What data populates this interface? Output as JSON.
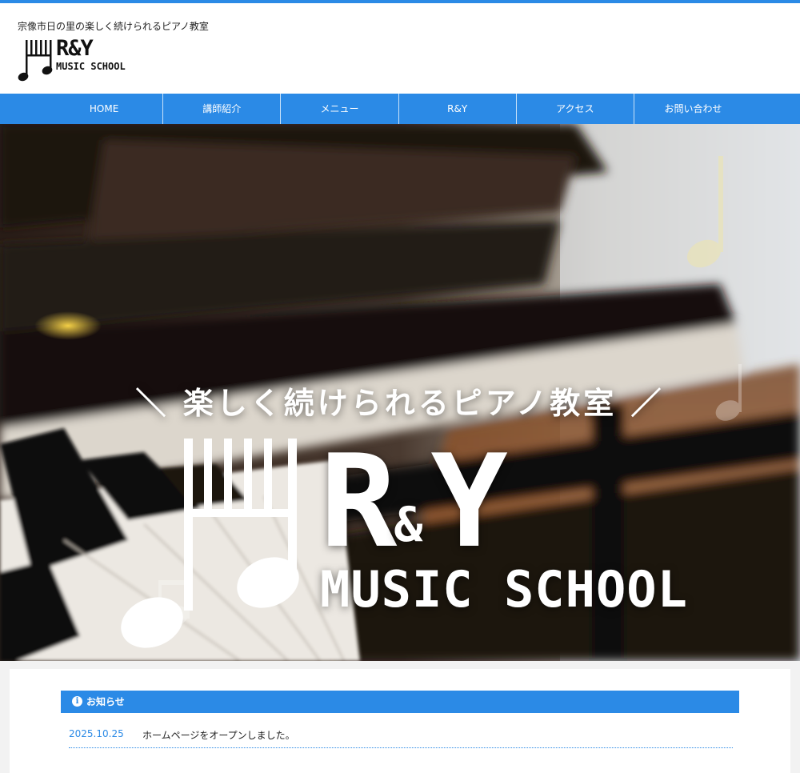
{
  "site": {
    "tagline": "宗像市日の里の楽しく続けられるピアノ教室",
    "logo": {
      "letters": "R&Y",
      "subtitle": "MUSIC SCHOOL",
      "icon": "piano-note-logo-icon"
    }
  },
  "nav": {
    "items": [
      {
        "label": "HOME"
      },
      {
        "label": "講師紹介"
      },
      {
        "label": "メニュー"
      },
      {
        "label": "R&Y"
      },
      {
        "label": "アクセス"
      },
      {
        "label": "お問い合わせ"
      }
    ]
  },
  "hero": {
    "tagline": "＼ 楽しく続けられるピアノ教室 ／",
    "logo": {
      "r": "R",
      "amp": "&",
      "y": "Y",
      "subtitle": "MUSIC SCHOOL"
    }
  },
  "news": {
    "title": "お知らせ",
    "icon": "info-icon",
    "items": [
      {
        "date": "2025.10.25",
        "text": "ホームページをオープンしました。"
      }
    ]
  },
  "colors": {
    "accent": "#2b8ae6",
    "white": "#ffffff",
    "text": "#222222"
  }
}
